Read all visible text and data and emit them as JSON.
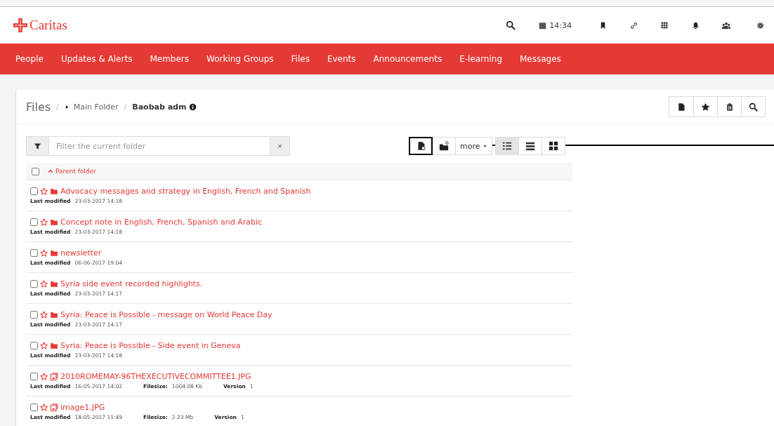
{
  "header": {
    "logo": "Caritas",
    "time": "14:34"
  },
  "nav": [
    "People",
    "Updates & Alerts",
    "Members",
    "Working Groups",
    "Files",
    "Events",
    "Announcements",
    "E-learning",
    "Messages"
  ],
  "breadcrumb": {
    "root": "Files",
    "separator_1": "/",
    "parent": "Main Folder",
    "separator_2": "/",
    "current": "Baobab adm"
  },
  "filter": {
    "placeholder": "Filter the current folder",
    "clear": "×"
  },
  "toolbar": {
    "more": "more",
    "views": [
      {
        "kind": "list",
        "selected": true
      },
      {
        "kind": "rows",
        "selected": false
      },
      {
        "kind": "grid",
        "selected": false
      }
    ],
    "highlighted": true
  },
  "list": {
    "parent": "Parent folder",
    "all_checked": false,
    "items": [
      {
        "kind": "folder",
        "name": "Advocacy messages and strategy in English, French and Spanish",
        "modified_label": "Last modified",
        "modified": "23-03-2017 14:18",
        "checked": false
      },
      {
        "kind": "folder",
        "name": "Concept note in English, French, Spanish and Arabic",
        "modified_label": "Last modified",
        "modified": "23-03-2017 14:18",
        "checked": false
      },
      {
        "kind": "folder",
        "name": "newsletter",
        "modified_label": "Last modified",
        "modified": "06-06-2017 19:04",
        "checked": false
      },
      {
        "kind": "folder",
        "name": "Syria side event recorded highlights.",
        "modified_label": "Last modified",
        "modified": "23-03-2017 14:17",
        "checked": false
      },
      {
        "kind": "folder",
        "name": "Syria: Peace is Possible - message on World Peace Day",
        "modified_label": "Last modified",
        "modified": "23-03-2017 14:17",
        "checked": false
      },
      {
        "kind": "folder",
        "name": "Syria: Peace is Possible - Side event in Geneva",
        "modified_label": "Last modified",
        "modified": "23-03-2017 14:18",
        "checked": false
      },
      {
        "kind": "file",
        "name": "2010ROMEMAY-96THEXECUTIVECOMMITTEE1.JPG",
        "modified_label": "Last modified",
        "modified": "16-05-2017 14:02",
        "size_label": "Filesize:",
        "size": "1004.08 Kb",
        "version_label": "Version",
        "version": "1",
        "checked": false
      },
      {
        "kind": "file",
        "name": "image1.JPG",
        "modified_label": "Last modified",
        "modified": "18-05-2017 11:49",
        "size_label": "Filesize:",
        "size": "2.23 Mb",
        "version_label": "Version",
        "version": "1",
        "checked": false
      }
    ]
  }
}
